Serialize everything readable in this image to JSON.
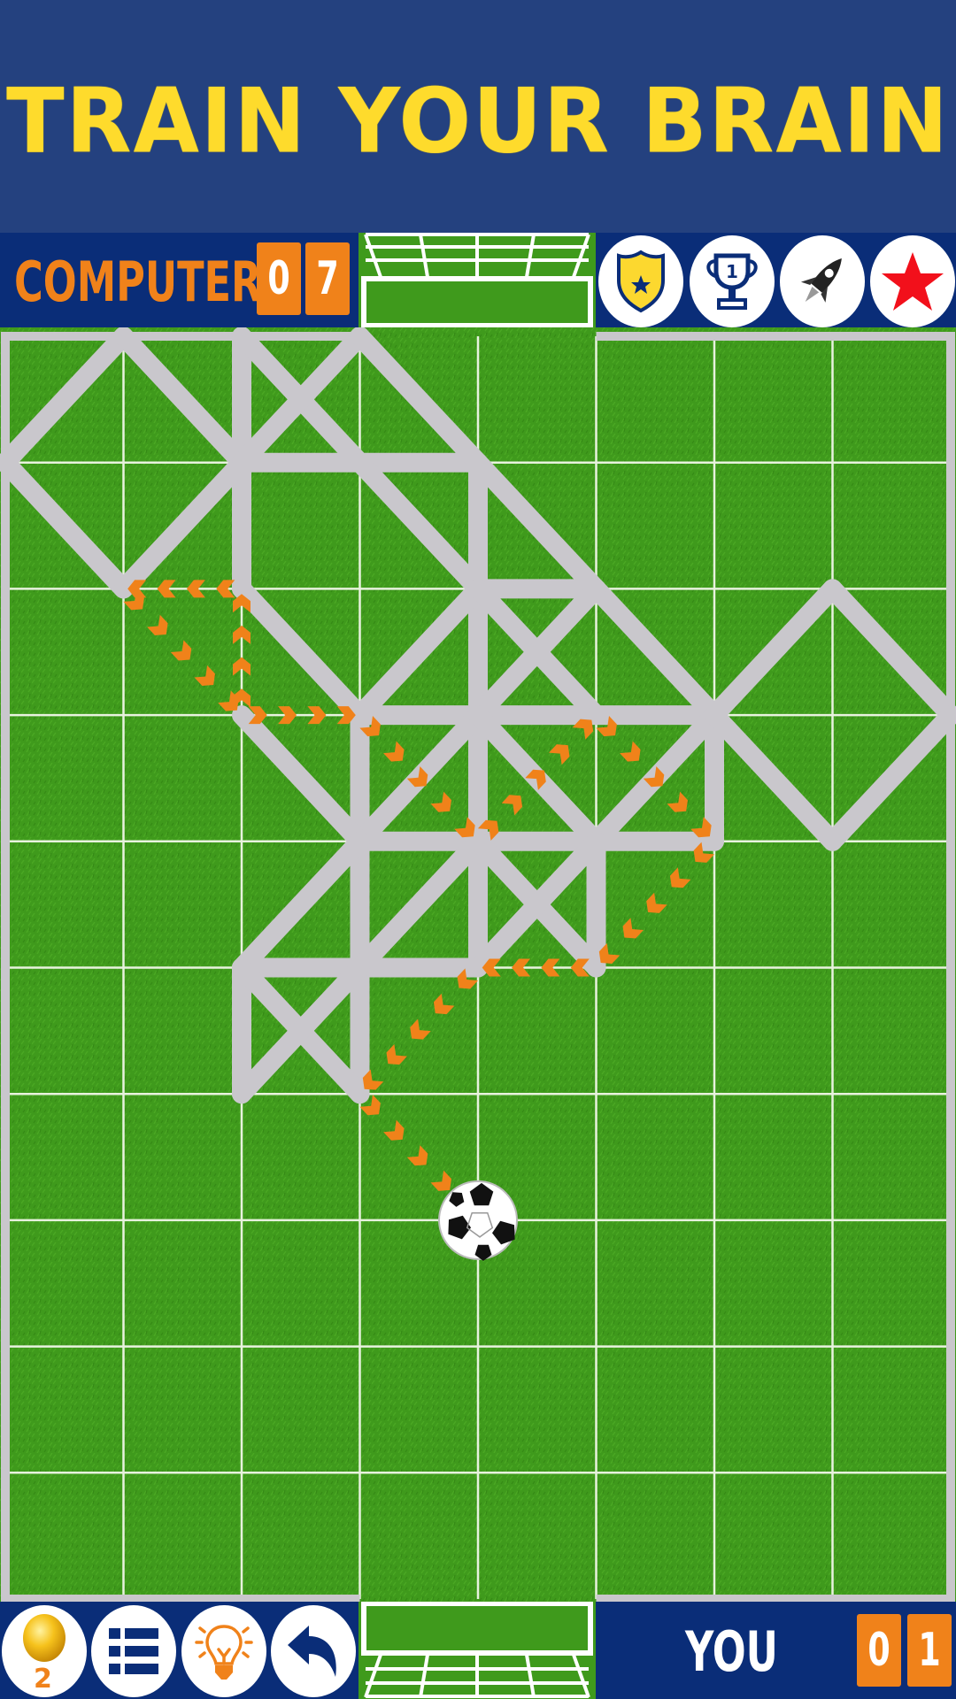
{
  "banner": {
    "title": "TRAIN YOUR BRAIN"
  },
  "colors": {
    "banner_bg": "#24417f",
    "bar_bg": "#0a2d78",
    "title": "#fedb2c",
    "accent_orange": "#f0821a",
    "played_line": "#c9c7cc",
    "grass": "#3f9a1c",
    "grid_line": "#e6f0dc"
  },
  "opponent": {
    "label": "COMPUTER",
    "score_digits": [
      "0",
      "7"
    ]
  },
  "player": {
    "label": "YOU",
    "score_digits": [
      "0",
      "1"
    ]
  },
  "top_icons": [
    {
      "name": "badge-icon",
      "label": "Badge"
    },
    {
      "name": "trophy-icon",
      "label": "Trophy",
      "text": "1"
    },
    {
      "name": "rocket-icon",
      "label": "Rocket"
    },
    {
      "name": "star-icon",
      "label": "Favorite"
    }
  ],
  "bottom_buttons": [
    {
      "name": "coin-button",
      "label": "Coins",
      "count": "2"
    },
    {
      "name": "menu-button",
      "label": "Menu"
    },
    {
      "name": "hint-button",
      "label": "Hint"
    },
    {
      "name": "undo-button",
      "label": "Undo"
    }
  ],
  "board": {
    "columns": 8,
    "rows": 10,
    "ball": [
      4,
      7
    ],
    "played_segments": [
      [
        [
          0,
          1
        ],
        [
          1,
          0
        ]
      ],
      [
        [
          1,
          0
        ],
        [
          2,
          1
        ]
      ],
      [
        [
          0,
          1
        ],
        [
          1,
          2
        ]
      ],
      [
        [
          1,
          2
        ],
        [
          2,
          1
        ]
      ],
      [
        [
          2,
          0
        ],
        [
          2,
          1
        ]
      ],
      [
        [
          2,
          1
        ],
        [
          2,
          2
        ]
      ],
      [
        [
          2,
          0
        ],
        [
          3,
          1
        ]
      ],
      [
        [
          2,
          1
        ],
        [
          3,
          0
        ]
      ],
      [
        [
          2,
          1
        ],
        [
          3,
          1
        ]
      ],
      [
        [
          3,
          1
        ],
        [
          4,
          1
        ]
      ],
      [
        [
          3,
          0
        ],
        [
          4,
          1
        ]
      ],
      [
        [
          4,
          1
        ],
        [
          5,
          2
        ]
      ],
      [
        [
          5,
          2
        ],
        [
          6,
          3
        ]
      ],
      [
        [
          3,
          1
        ],
        [
          4,
          2
        ]
      ],
      [
        [
          4,
          1
        ],
        [
          4,
          2
        ]
      ],
      [
        [
          4,
          2
        ],
        [
          4,
          3
        ]
      ],
      [
        [
          4,
          3
        ],
        [
          4,
          4
        ]
      ],
      [
        [
          4,
          4
        ],
        [
          4,
          5
        ]
      ],
      [
        [
          4,
          2
        ],
        [
          5,
          2
        ]
      ],
      [
        [
          2,
          2
        ],
        [
          3,
          3
        ]
      ],
      [
        [
          3,
          3
        ],
        [
          4,
          2
        ]
      ],
      [
        [
          4,
          2
        ],
        [
          5,
          3
        ]
      ],
      [
        [
          4,
          3
        ],
        [
          5,
          2
        ]
      ],
      [
        [
          3,
          3
        ],
        [
          4,
          3
        ]
      ],
      [
        [
          4,
          3
        ],
        [
          5,
          3
        ]
      ],
      [
        [
          5,
          3
        ],
        [
          6,
          3
        ]
      ],
      [
        [
          3,
          3
        ],
        [
          3,
          4
        ]
      ],
      [
        [
          3,
          4
        ],
        [
          3,
          5
        ]
      ],
      [
        [
          3,
          5
        ],
        [
          3,
          6
        ]
      ],
      [
        [
          3,
          4
        ],
        [
          4,
          3
        ]
      ],
      [
        [
          4,
          3
        ],
        [
          5,
          4
        ]
      ],
      [
        [
          5,
          4
        ],
        [
          6,
          3
        ]
      ],
      [
        [
          6,
          3
        ],
        [
          6,
          4
        ]
      ],
      [
        [
          3,
          4
        ],
        [
          4,
          4
        ]
      ],
      [
        [
          4,
          4
        ],
        [
          5,
          4
        ]
      ],
      [
        [
          5,
          4
        ],
        [
          6,
          4
        ]
      ],
      [
        [
          6,
          3
        ],
        [
          7,
          2
        ]
      ],
      [
        [
          7,
          2
        ],
        [
          8,
          3
        ]
      ],
      [
        [
          8,
          3
        ],
        [
          7,
          4
        ]
      ],
      [
        [
          7,
          4
        ],
        [
          6,
          3
        ]
      ],
      [
        [
          2,
          3
        ],
        [
          3,
          4
        ]
      ],
      [
        [
          2,
          5
        ],
        [
          3,
          4
        ]
      ],
      [
        [
          3,
          5
        ],
        [
          4,
          4
        ]
      ],
      [
        [
          4,
          4
        ],
        [
          5,
          5
        ]
      ],
      [
        [
          4,
          5
        ],
        [
          5,
          4
        ]
      ],
      [
        [
          5,
          4
        ],
        [
          5,
          5
        ]
      ],
      [
        [
          2,
          5
        ],
        [
          3,
          5
        ]
      ],
      [
        [
          3,
          5
        ],
        [
          4,
          5
        ]
      ],
      [
        [
          2,
          5
        ],
        [
          2,
          6
        ]
      ],
      [
        [
          2,
          5
        ],
        [
          3,
          6
        ]
      ],
      [
        [
          2,
          6
        ],
        [
          3,
          5
        ]
      ]
    ],
    "last_move_path": [
      [
        2,
        3
      ],
      [
        2,
        2
      ],
      [
        1,
        2
      ],
      [
        2,
        3
      ],
      [
        3,
        3
      ],
      [
        4,
        4
      ],
      [
        5,
        3
      ],
      [
        6,
        4
      ],
      [
        5,
        5
      ],
      [
        4,
        5
      ],
      [
        3,
        6
      ],
      [
        4,
        7
      ]
    ]
  }
}
